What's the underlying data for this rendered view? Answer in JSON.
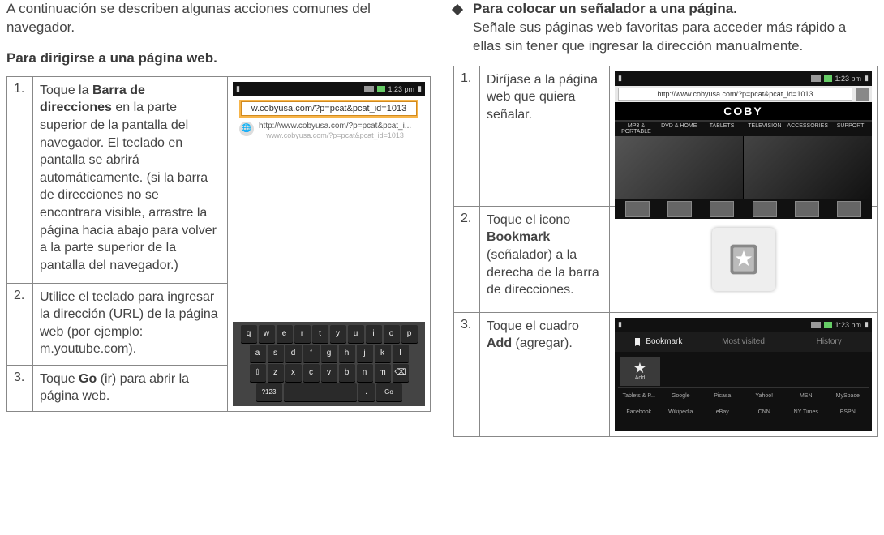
{
  "left": {
    "intro": "A continuación se describen algunas acciones comunes del navegador.",
    "heading": "Para dirigirse a una página web.",
    "steps": [
      {
        "num": "1.",
        "text_pre": "Toque la ",
        "text_bold": "Barra de direcciones",
        "text_post": " en la parte superior de la pantalla del navegador. El teclado en pantalla se abrirá automáticamente. (si la barra de direcciones no se encontrara visible, arrastre la página hacia abajo para volver a la parte superior de la pantalla del navegador.)"
      },
      {
        "num": "2.",
        "text_pre": "Utilice el teclado para ingresar la dirección (URL) de la página web (por ejemplo: m.youtube.com).",
        "text_bold": "",
        "text_post": ""
      },
      {
        "num": "3.",
        "text_pre": "Toque ",
        "text_bold": "Go",
        "text_post": " (ir) para abrir la página web."
      }
    ],
    "screenshot": {
      "time": "1:23 pm",
      "address_value": "w.cobyusa.com/?p=pcat&pcat_id=1013",
      "suggest_line1": "http://www.cobyusa.com/?p=pcat&pcat_i...",
      "suggest_line2": "www.cobyusa.com/?p=pcat&pcat_id=1013",
      "keys_row1": [
        "q",
        "w",
        "e",
        "r",
        "t",
        "y",
        "u",
        "i",
        "o",
        "p"
      ],
      "keys_row2": [
        "a",
        "s",
        "d",
        "f",
        "g",
        "h",
        "j",
        "k",
        "l"
      ],
      "keys_row3": [
        "⇧",
        "z",
        "x",
        "c",
        "v",
        "b",
        "n",
        "m",
        "⌫"
      ],
      "keys_row4_left": "?123",
      "keys_row4_right": "Go"
    }
  },
  "right": {
    "heading": "Para colocar un señalador a una página.",
    "subtext": "Señale sus páginas web favoritas para acceder más rápido a ellas sin tener que ingresar la dirección manualmente.",
    "steps": [
      {
        "num": "1.",
        "text_pre": "Diríjase a la página web que quiera señalar.",
        "text_bold": "",
        "text_post": ""
      },
      {
        "num": "2.",
        "text_pre": "Toque el icono ",
        "text_bold": "Bookmark",
        "text_post": " (señalador) a la derecha de la barra de direcciones."
      },
      {
        "num": "3.",
        "text_pre": "Toque el cuadro ",
        "text_bold": "Add",
        "text_post": " (agregar)."
      }
    ],
    "shot1": {
      "time": "1:23 pm",
      "url": "http://www.cobyusa.com/?p=pcat&pcat_id=1013",
      "brand": "COBY",
      "tabs": [
        "MP3 & PORTABLE",
        "DVD & HOME",
        "TABLETS",
        "TELEVISION",
        "ACCESSORIES",
        "SUPPORT"
      ]
    },
    "shot3": {
      "time": "1:23 pm",
      "tabs": [
        "Bookmark",
        "Most visited",
        "History"
      ],
      "add_label": "Add",
      "row1": [
        "Tablets & P...",
        "Google",
        "Picasa",
        "Yahoo!",
        "MSN",
        "MySpace"
      ],
      "row2": [
        "Facebook",
        "Wikipedia",
        "eBay",
        "CNN",
        "NY Times",
        "ESPN"
      ]
    }
  }
}
